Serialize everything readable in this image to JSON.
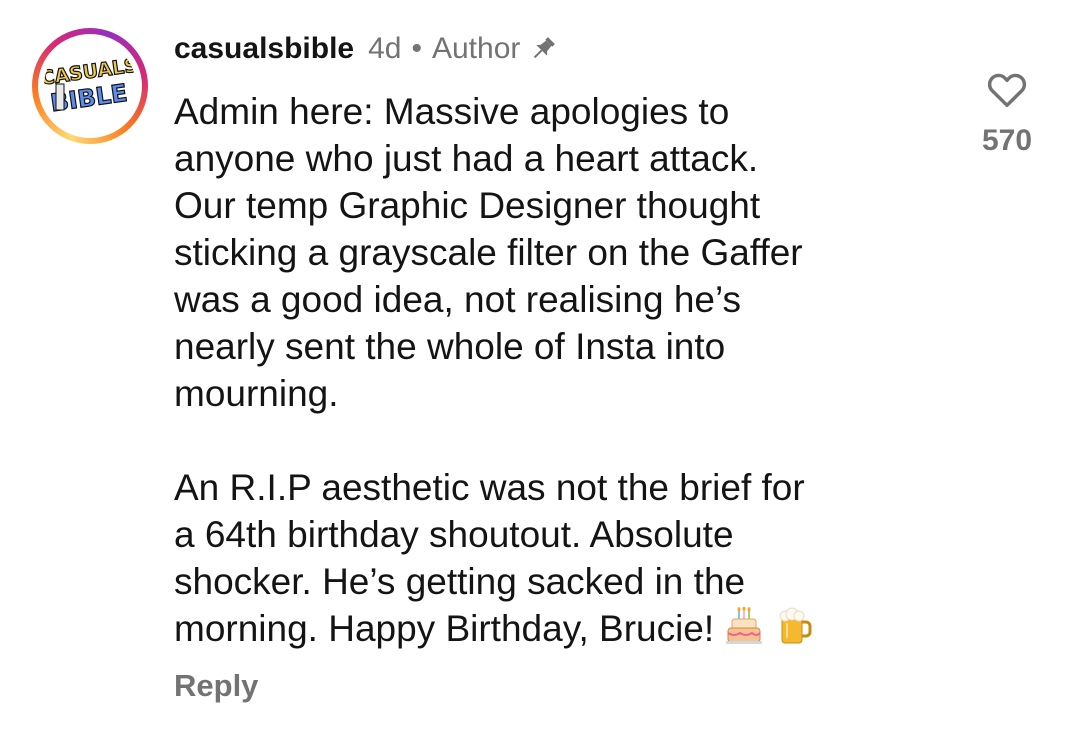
{
  "avatar": {
    "logo_text_line1": "CASUALS",
    "logo_text_line2": "BIBLE",
    "ring_colors": [
      "#feda75",
      "#fa7e1e",
      "#d62976",
      "#962fbf"
    ]
  },
  "comment": {
    "username": "casualsbible",
    "time": "4d",
    "separator": "•",
    "role": "Author",
    "pinned": true,
    "paragraph_1": "Admin here: Massive apologies to\nanyone who just had a heart attack.\nOur temp Graphic Designer thought\nsticking a grayscale filter on the Gaffer\nwas a good idea, not realising he’s\nnearly sent the whole of Insta into\nmourning.",
    "paragraph_2": "An R.I.P aesthetic was not the brief for\na 64th birthday shoutout. Absolute\nshocker. He’s getting sacked in the\nmorning. Happy Birthday, Brucie!",
    "emojis": [
      "birthday-cake-emoji",
      "beer-mug-emoji"
    ],
    "reply_label": "Reply",
    "like_icon": "heart-icon",
    "like_count": "570"
  },
  "colors": {
    "text_primary": "#141414",
    "text_secondary": "#737373",
    "background": "#ffffff"
  }
}
